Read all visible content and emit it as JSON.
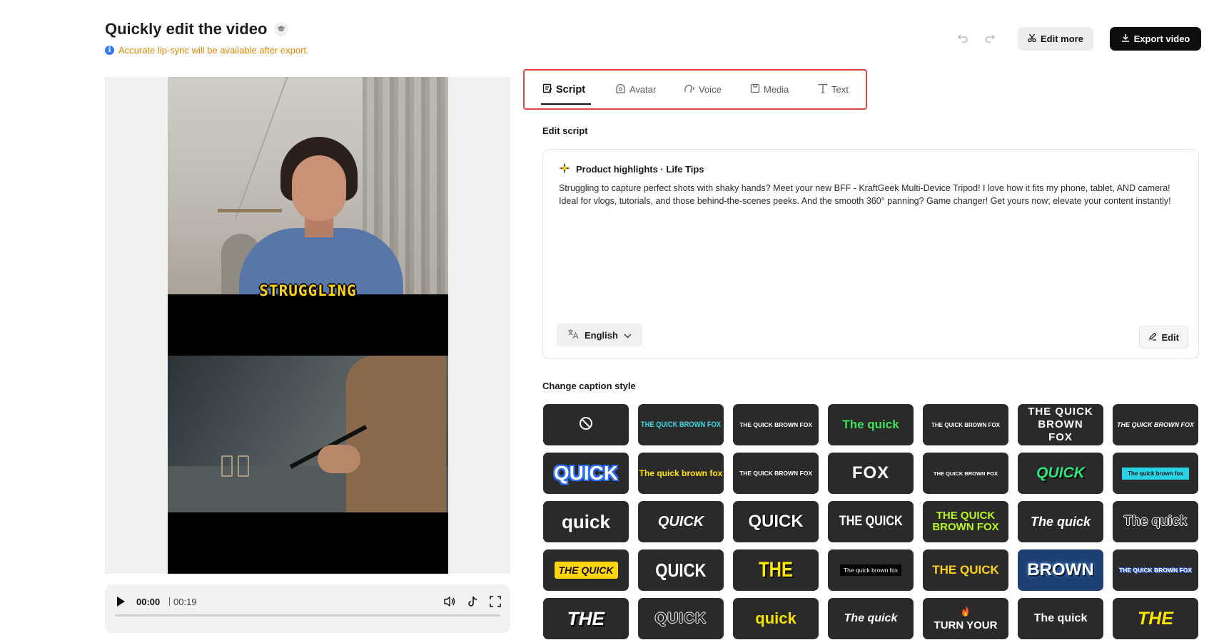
{
  "header": {
    "title": "Quickly edit the video",
    "notice": "Accurate lip-sync will be available after export.",
    "edit_more": "Edit more",
    "export": "Export video"
  },
  "video": {
    "caption": "STRUGGLING"
  },
  "player": {
    "current_time": "00:00",
    "total_time": "00:19",
    "progress": 0
  },
  "tabs": [
    {
      "label": "Script",
      "icon": "script-icon",
      "active": true
    },
    {
      "label": "Avatar",
      "icon": "avatar-icon",
      "active": false
    },
    {
      "label": "Voice",
      "icon": "voice-icon",
      "active": false
    },
    {
      "label": "Media",
      "icon": "media-icon",
      "active": false
    },
    {
      "label": "Text",
      "icon": "text-icon",
      "active": false
    }
  ],
  "script": {
    "section_label": "Edit script",
    "heading": "Product highlights · Life Tips",
    "body": "Struggling to capture perfect shots with shaky hands? Meet your new BFF - KraftGeek Multi-Device Tripod! I love how it fits my phone, tablet, AND camera! Ideal for vlogs, tutorials, and those behind-the-scenes peeks. And the smooth 360° panning? Game changer! Get yours now; elevate your content instantly!",
    "language": "English",
    "edit_label": "Edit"
  },
  "caption_styles": {
    "section_label": "Change caption style",
    "styles": [
      {
        "text": "",
        "name": "none"
      },
      {
        "text": "THE QUICK BROWN FOX"
      },
      {
        "text": "THE QUICK BROWN FOX"
      },
      {
        "text": "The quick"
      },
      {
        "text": "THE QUICK BROWN FOX"
      },
      {
        "text": "THE QUICK BROWN FOX"
      },
      {
        "text": "THE QUICK BROWN FOX"
      },
      {
        "text": "QUICK"
      },
      {
        "text": "The quick brown fox"
      },
      {
        "text": "THE QUICK BROWN FOX"
      },
      {
        "text": "FOX"
      },
      {
        "text": "THE QUICK BROWN FOX"
      },
      {
        "text": "QUICK"
      },
      {
        "text": "The quick brown fox"
      },
      {
        "text": "quick"
      },
      {
        "text": "QUICK"
      },
      {
        "text": "QUICK"
      },
      {
        "text": "THE QUICK"
      },
      {
        "text": "THE QUICK BROWN FOX"
      },
      {
        "text": "The quick"
      },
      {
        "text": "The quick"
      },
      {
        "text": "THE QUICK"
      },
      {
        "text": "QUICK"
      },
      {
        "text": "THE"
      },
      {
        "text": "The quick brown fox"
      },
      {
        "text": "THE QUICK"
      },
      {
        "text": "BROWN"
      },
      {
        "text": "THE QUICK BROWN FOX"
      },
      {
        "text": "THE"
      },
      {
        "text": "QUICK"
      },
      {
        "text": "quick"
      },
      {
        "text": "The quick"
      },
      {
        "text": "TURN YOUR"
      },
      {
        "text": "The quick"
      },
      {
        "text": "THE"
      }
    ]
  }
}
